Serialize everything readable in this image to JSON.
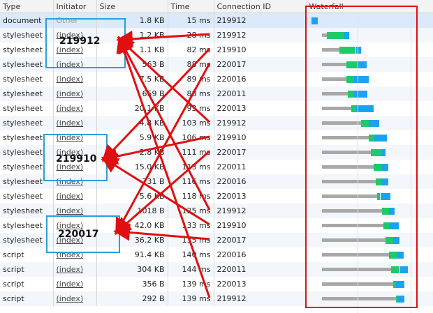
{
  "columns": [
    "Type",
    "Initiator",
    "Size",
    "Time",
    "Connection ID",
    "Waterfall"
  ],
  "rows": [
    {
      "type": "document",
      "initiator": "Other",
      "size": "1.8 KB",
      "time": "15 ms",
      "conn": "219912"
    },
    {
      "type": "stylesheet",
      "initiator": "(index)",
      "size": "1.2 KB",
      "time": "28 ms",
      "conn": "219912"
    },
    {
      "type": "stylesheet",
      "initiator": "(index)",
      "size": "1.1 KB",
      "time": "82 ms",
      "conn": "219910"
    },
    {
      "type": "stylesheet",
      "initiator": "(index)",
      "size": "563 B",
      "time": "88 ms",
      "conn": "220017"
    },
    {
      "type": "stylesheet",
      "initiator": "(index)",
      "size": "7.5 KB",
      "time": "89 ms",
      "conn": "220016"
    },
    {
      "type": "stylesheet",
      "initiator": "(index)",
      "size": "659 B",
      "time": "88 ms",
      "conn": "220011"
    },
    {
      "type": "stylesheet",
      "initiator": "(index)",
      "size": "20.1 KB",
      "time": "93 ms",
      "conn": "220013"
    },
    {
      "type": "stylesheet",
      "initiator": "(index)",
      "size": "4.8 KB",
      "time": "103 ms",
      "conn": "219912"
    },
    {
      "type": "stylesheet",
      "initiator": "(index)",
      "size": "5.9 KB",
      "time": "106 ms",
      "conn": "219910"
    },
    {
      "type": "stylesheet",
      "initiator": "(index)",
      "size": "2.8 KB",
      "time": "111 ms",
      "conn": "220017"
    },
    {
      "type": "stylesheet",
      "initiator": "(index)",
      "size": "15.0 KB",
      "time": "113 ms",
      "conn": "220011"
    },
    {
      "type": "stylesheet",
      "initiator": "(index)",
      "size": "731 B",
      "time": "116 ms",
      "conn": "220016"
    },
    {
      "type": "stylesheet",
      "initiator": "(index)",
      "size": "5.6 KB",
      "time": "118 ms",
      "conn": "220013"
    },
    {
      "type": "stylesheet",
      "initiator": "(index)",
      "size": "1018 B",
      "time": "125 ms",
      "conn": "219912"
    },
    {
      "type": "stylesheet",
      "initiator": "(index)",
      "size": "42.0 KB",
      "time": "133 ms",
      "conn": "219910"
    },
    {
      "type": "stylesheet",
      "initiator": "(index)",
      "size": "36.2 KB",
      "time": "135 ms",
      "conn": "220017"
    },
    {
      "type": "script",
      "initiator": "(index)",
      "size": "91.4 KB",
      "time": "140 ms",
      "conn": "220016"
    },
    {
      "type": "script",
      "initiator": "(index)",
      "size": "304 KB",
      "time": "144 ms",
      "conn": "220011"
    },
    {
      "type": "script",
      "initiator": "(index)",
      "size": "356 B",
      "time": "139 ms",
      "conn": "220013"
    },
    {
      "type": "script",
      "initiator": "(index)",
      "size": "292 B",
      "time": "139 ms",
      "conn": "219912"
    }
  ],
  "waterfall": [
    {
      "wait": 0,
      "ttfb": 0,
      "dl": 0.07
    },
    {
      "wait": 0.05,
      "ttfb": 0.18,
      "dl": 0.05
    },
    {
      "wait": 0.18,
      "ttfb": 0.17,
      "dl": 0.05
    },
    {
      "wait": 0.25,
      "ttfb": 0.11,
      "dl": 0.1
    },
    {
      "wait": 0.25,
      "ttfb": 0.08,
      "dl": 0.15
    },
    {
      "wait": 0.27,
      "ttfb": 0.06,
      "dl": 0.14
    },
    {
      "wait": 0.3,
      "ttfb": 0.05,
      "dl": 0.18
    },
    {
      "wait": 0.4,
      "ttfb": 0.08,
      "dl": 0.11
    },
    {
      "wait": 0.48,
      "ttfb": 0.06,
      "dl": 0.13
    },
    {
      "wait": 0.5,
      "ttfb": 0.1,
      "dl": 0.05
    },
    {
      "wait": 0.53,
      "ttfb": 0.08,
      "dl": 0.07
    },
    {
      "wait": 0.55,
      "ttfb": 0.06,
      "dl": 0.07
    },
    {
      "wait": 0.57,
      "ttfb": 0.03,
      "dl": 0.1
    },
    {
      "wait": 0.62,
      "ttfb": 0.07,
      "dl": 0.06
    },
    {
      "wait": 0.63,
      "ttfb": 0.06,
      "dl": 0.1
    },
    {
      "wait": 0.65,
      "ttfb": 0.08,
      "dl": 0.07
    },
    {
      "wait": 0.69,
      "ttfb": 0.08,
      "dl": 0.07
    },
    {
      "wait": 0.71,
      "ttfb": 0.09,
      "dl": 0.08
    },
    {
      "wait": 0.73,
      "ttfb": 0.03,
      "dl": 0.09
    },
    {
      "wait": 0.76,
      "ttfb": 0.02,
      "dl": 0.07
    }
  ],
  "annotations": {
    "labels": [
      "219912",
      "219910",
      "220017"
    ],
    "highlight_color": "#2a9fd6",
    "arrow_color": "#e01010",
    "waterfall_box_color": "#e01010"
  },
  "colors": {
    "wait": "#a8a8a8",
    "ttfb": "#1ec968",
    "download": "#1aa3f0",
    "selected_row": "#dbe9fa"
  }
}
